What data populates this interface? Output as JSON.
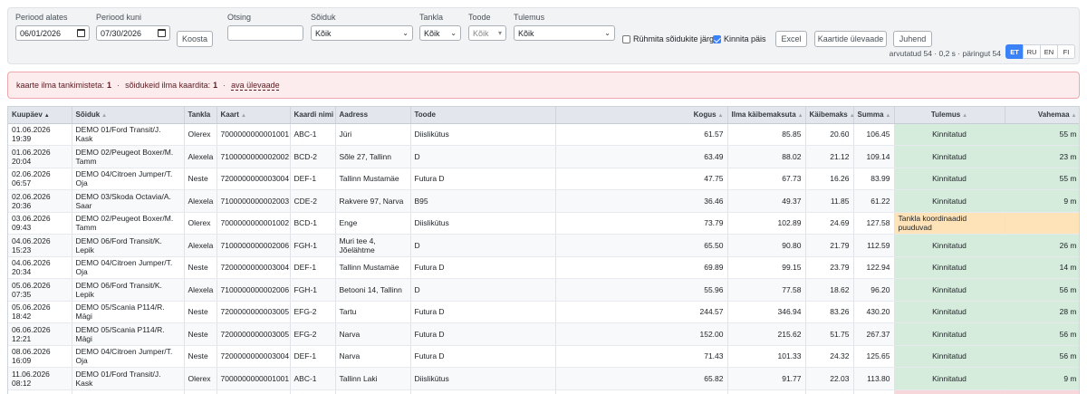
{
  "filters": {
    "period_from": {
      "label": "Periood alates",
      "value": "06/01/2026"
    },
    "period_to": {
      "label": "Periood kuni",
      "value": "07/30/2026"
    },
    "build_label": "Koosta",
    "search": {
      "label": "Otsing",
      "value": ""
    },
    "vehicle": {
      "label": "Sõiduk",
      "value": "Kõik"
    },
    "station": {
      "label": "Tankla",
      "value": "Kõik"
    },
    "product": {
      "label": "Toode",
      "value": "Kõik"
    },
    "result": {
      "label": "Tulemus",
      "value": "Kõik"
    },
    "group_by_vehicle": {
      "label": "Rühmita sõidukite järgi",
      "checked": false
    },
    "pin_header": {
      "label": "Kinnita päis",
      "checked": true
    },
    "excel_label": "Excel",
    "cards_overview_label": "Kaartide ülevaade",
    "guide_label": "Juhend",
    "stats_text": "arvutatud 54 · 0,2 s · päringut 54",
    "languages": [
      {
        "code": "ET",
        "active": true
      },
      {
        "code": "RU",
        "active": false
      },
      {
        "code": "EN",
        "active": false
      },
      {
        "code": "FI",
        "active": false
      }
    ]
  },
  "alert": {
    "cards_text": "kaarte ilma tankimisteta:",
    "cards_count": "1",
    "separator": "·",
    "vehicles_text": "sõidukeid ilma kaardita:",
    "vehicles_count": "1",
    "link_label": "ava ülevaade"
  },
  "table": {
    "columns": [
      "Kuupäev",
      "Sõiduk",
      "Tankla",
      "Kaart",
      "Kaardi nimi",
      "Aadress",
      "Toode",
      "Kogus",
      "Ilma käibemaksuta",
      "Käibemaks",
      "Summa",
      "Tulemus",
      "Vahemaa"
    ],
    "rows": [
      {
        "date": "01.06.2026",
        "time": "19:39",
        "vehicle": "DEMO 01/Ford Transit/J. Kask",
        "station": "Olerex",
        "card": "7000000000001001",
        "card_name": "ABC-1",
        "address": "Jüri",
        "product": "Diislikütus",
        "qty": "61.57",
        "net": "85.85",
        "vat": "20.60",
        "sum": "106.45",
        "result": "Kinnitatud",
        "status": "ok",
        "distance": "55 m"
      },
      {
        "date": "01.06.2026",
        "time": "20:04",
        "vehicle": "DEMO 02/Peugeot Boxer/M. Tamm",
        "station": "Alexela",
        "card": "7100000000002002",
        "card_name": "BCD-2",
        "address": "Sõle 27, Tallinn",
        "product": "D",
        "qty": "63.49",
        "net": "88.02",
        "vat": "21.12",
        "sum": "109.14",
        "result": "Kinnitatud",
        "status": "ok",
        "distance": "23 m"
      },
      {
        "date": "02.06.2026",
        "time": "06:57",
        "vehicle": "DEMO 04/Citroen Jumper/T. Oja",
        "station": "Neste",
        "card": "7200000000003004",
        "card_name": "DEF-1",
        "address": "Tallinn Mustamäe",
        "product": "Futura D",
        "qty": "47.75",
        "net": "67.73",
        "vat": "16.26",
        "sum": "83.99",
        "result": "Kinnitatud",
        "status": "ok",
        "distance": "55 m"
      },
      {
        "date": "02.06.2026",
        "time": "20:36",
        "vehicle": "DEMO 03/Skoda Octavia/A. Saar",
        "station": "Alexela",
        "card": "7100000000002003",
        "card_name": "CDE-2",
        "address": "Rakvere 97, Narva",
        "product": "B95",
        "qty": "36.46",
        "net": "49.37",
        "vat": "11.85",
        "sum": "61.22",
        "result": "Kinnitatud",
        "status": "ok",
        "distance": "9 m"
      },
      {
        "date": "03.06.2026",
        "time": "09:43",
        "vehicle": "DEMO 02/Peugeot Boxer/M. Tamm",
        "station": "Olerex",
        "card": "7000000000001002",
        "card_name": "BCD-1",
        "address": "Enge",
        "product": "Diislikütus",
        "qty": "73.79",
        "net": "102.89",
        "vat": "24.69",
        "sum": "127.58",
        "result": "Tankla koordinaadid puuduvad",
        "status": "warn",
        "distance": ""
      },
      {
        "date": "04.06.2026",
        "time": "15:23",
        "vehicle": "DEMO 06/Ford Transit/K. Lepik",
        "station": "Alexela",
        "card": "7100000000002006",
        "card_name": "FGH-1",
        "address": "Muri tee 4, Jõelähtme",
        "product": "D",
        "qty": "65.50",
        "net": "90.80",
        "vat": "21.79",
        "sum": "112.59",
        "result": "Kinnitatud",
        "status": "ok",
        "distance": "26 m"
      },
      {
        "date": "04.06.2026",
        "time": "20:34",
        "vehicle": "DEMO 04/Citroen Jumper/T. Oja",
        "station": "Neste",
        "card": "7200000000003004",
        "card_name": "DEF-1",
        "address": "Tallinn Mustamäe",
        "product": "Futura D",
        "qty": "69.89",
        "net": "99.15",
        "vat": "23.79",
        "sum": "122.94",
        "result": "Kinnitatud",
        "status": "ok",
        "distance": "14 m"
      },
      {
        "date": "05.06.2026",
        "time": "07:35",
        "vehicle": "DEMO 06/Ford Transit/K. Lepik",
        "station": "Alexela",
        "card": "7100000000002006",
        "card_name": "FGH-1",
        "address": "Betooni 14, Tallinn",
        "product": "D",
        "qty": "55.96",
        "net": "77.58",
        "vat": "18.62",
        "sum": "96.20",
        "result": "Kinnitatud",
        "status": "ok",
        "distance": "56 m"
      },
      {
        "date": "05.06.2026",
        "time": "18:42",
        "vehicle": "DEMO 05/Scania P114/R. Mägi",
        "station": "Neste",
        "card": "7200000000003005",
        "card_name": "EFG-2",
        "address": "Tartu",
        "product": "Futura D",
        "qty": "244.57",
        "net": "346.94",
        "vat": "83.26",
        "sum": "430.20",
        "result": "Kinnitatud",
        "status": "ok",
        "distance": "28 m"
      },
      {
        "date": "06.06.2026",
        "time": "12:21",
        "vehicle": "DEMO 05/Scania P114/R. Mägi",
        "station": "Neste",
        "card": "7200000000003005",
        "card_name": "EFG-2",
        "address": "Narva",
        "product": "Futura D",
        "qty": "152.00",
        "net": "215.62",
        "vat": "51.75",
        "sum": "267.37",
        "result": "Kinnitatud",
        "status": "ok",
        "distance": "56 m"
      },
      {
        "date": "08.06.2026",
        "time": "16:09",
        "vehicle": "DEMO 04/Citroen Jumper/T. Oja",
        "station": "Neste",
        "card": "7200000000003004",
        "card_name": "DEF-1",
        "address": "Narva",
        "product": "Futura D",
        "qty": "71.43",
        "net": "101.33",
        "vat": "24.32",
        "sum": "125.65",
        "result": "Kinnitatud",
        "status": "ok",
        "distance": "56 m"
      },
      {
        "date": "11.06.2026",
        "time": "08:12",
        "vehicle": "DEMO 01/Ford Transit/J. Kask",
        "station": "Olerex",
        "card": "7000000000001001",
        "card_name": "ABC-1",
        "address": "Tallinn Laki",
        "product": "Diislikütus",
        "qty": "65.82",
        "net": "91.77",
        "vat": "22.03",
        "sum": "113.80",
        "result": "Kinnitatud",
        "status": "ok",
        "distance": "9 m"
      },
      {
        "date": "",
        "time": "",
        "vehicle": "",
        "station": "",
        "card": "",
        "card_name": "",
        "address": "",
        "product": "",
        "qty": "",
        "net": "",
        "vat": "",
        "sum": "",
        "result": "",
        "status": "bad",
        "distance": ""
      }
    ]
  }
}
